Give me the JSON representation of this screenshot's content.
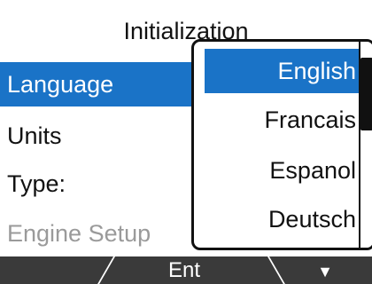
{
  "header": {
    "title": "Initialization"
  },
  "menu": {
    "items": [
      {
        "label": "Language"
      },
      {
        "label": "Units"
      },
      {
        "label": "Type:"
      },
      {
        "label": "Engine Setup"
      }
    ]
  },
  "popup": {
    "options": [
      {
        "label": "English"
      },
      {
        "label": "Francais"
      },
      {
        "label": "Espanol"
      },
      {
        "label": "Deutsch"
      }
    ],
    "selected": "English"
  },
  "softkeys": {
    "left": "",
    "center": "Ent",
    "right_icon": "down-arrow",
    "right": "▼"
  },
  "colors": {
    "accent": "#1a73c7",
    "softbar": "#3a3a3a",
    "disabled_text": "#9a9a9a"
  }
}
